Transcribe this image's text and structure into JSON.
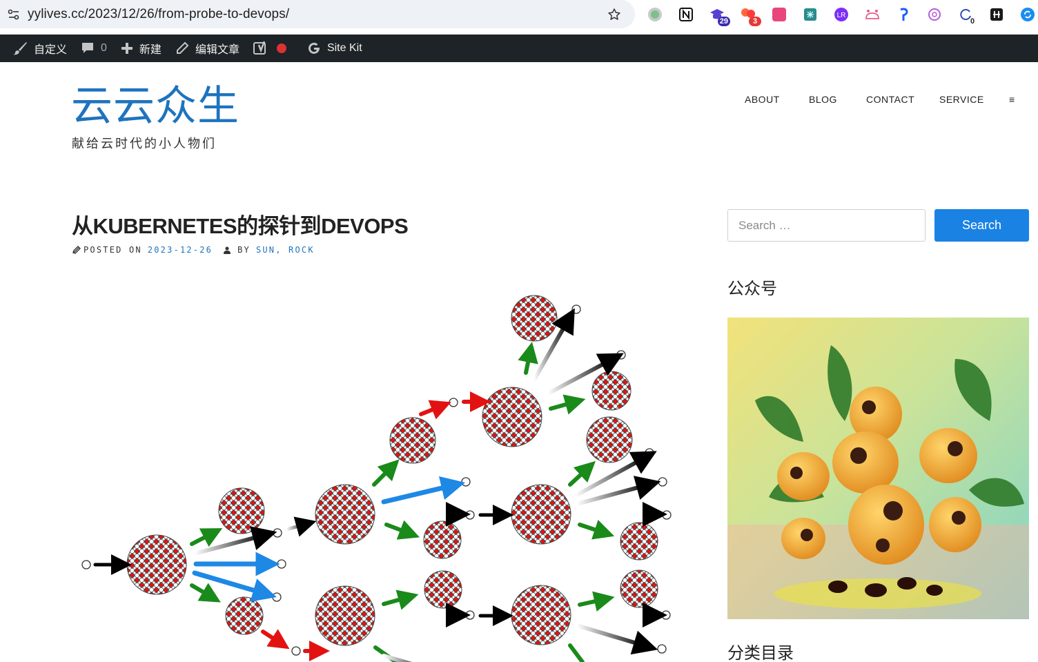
{
  "browser": {
    "url": "yylives.cc/2023/12/26/from-probe-to-devops/",
    "extensions": [
      {
        "icon": "circle-gray-icon",
        "badge": ""
      },
      {
        "icon": "notion-icon",
        "badge": ""
      },
      {
        "icon": "graduation-cap-icon",
        "badge": "29"
      },
      {
        "icon": "bubbles-icon",
        "badge": "3"
      },
      {
        "icon": "translate-icon",
        "badge": ""
      },
      {
        "icon": "brain-icon",
        "badge": ""
      },
      {
        "icon": "lr-icon",
        "badge": ""
      },
      {
        "icon": "crown-icon",
        "badge": ""
      },
      {
        "icon": "paragraph-icon",
        "badge": ""
      },
      {
        "icon": "openai-icon",
        "badge": ""
      },
      {
        "icon": "refresh-icon",
        "badge": "0"
      },
      {
        "icon": "hashnode-icon",
        "badge": ""
      },
      {
        "icon": "sync-icon",
        "badge": ""
      }
    ]
  },
  "admin_bar": {
    "customize": "自定义",
    "comments": "0",
    "new": "新建",
    "edit": "编辑文章",
    "sitekit": "Site Kit"
  },
  "site": {
    "title": "云云众生",
    "description": "献给云时代的小人物们"
  },
  "nav": {
    "about": "ABOUT",
    "blog": "BLOG",
    "contact": "CONTACT",
    "service": "SERVICE",
    "menu": "≡"
  },
  "post": {
    "title": "从KUBERNETES的探针到DEVOPS",
    "posted_on": "POSTED ON",
    "date": "2023-12-26",
    "by": "BY",
    "author": "SUN, ROCK"
  },
  "sidebar": {
    "search_placeholder": "Search …",
    "search_button": "Search",
    "widget1_title": "公众号",
    "widget2_title": "分类目录"
  },
  "colors": {
    "accent": "#1e73be",
    "button": "#1a82e2",
    "admin_bar": "#1d2327"
  }
}
